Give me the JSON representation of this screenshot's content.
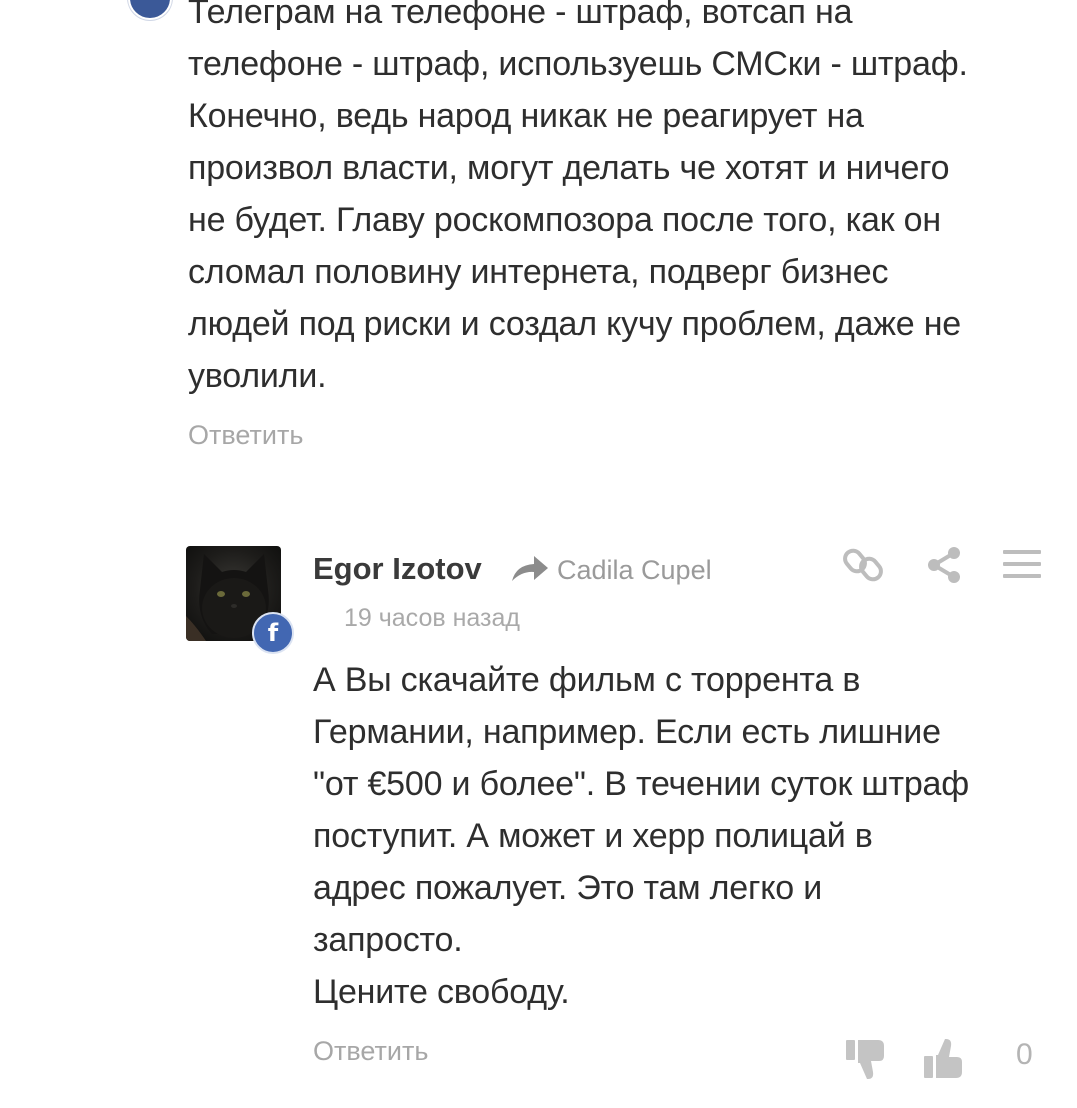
{
  "comment_prev": {
    "text_lines": [
      "Телеграм на телефоне - штраф, вотсап на",
      "телефоне - штраф, используешь СМСки - штраф.",
      "Конечно, ведь народ никак не реагирует на",
      "произвол власти, могут делать че хотят и ничего",
      "не будет. Главу роскомпозора после того, как он",
      "сломал половину интернета, подверг бизнес",
      "людей под риски и создал кучу проблем, даже не",
      "уволили."
    ],
    "reply_label": "Ответить"
  },
  "comment": {
    "author": "Egor Izotov",
    "reply_to": "Cadila Cupel",
    "time": "19 часов назад",
    "network_badge": "f",
    "text_lines": [
      "А Вы скачайте фильм с торрента в",
      "Германии, например. Если есть лишние",
      "\"от €500 и более\". В течении суток штраф",
      "поступит. А может и херр полицай в",
      "адрес пожалует. Это там легко и",
      "запросто.",
      "Цените свободу."
    ],
    "reply_label": "Ответить",
    "score": "0"
  },
  "icons": {
    "link": "link-icon",
    "share": "share-icon",
    "menu": "menu-icon",
    "reply_arrow": "reply-arrow-icon",
    "dislike": "thumbs-down-icon",
    "like": "thumbs-up-icon",
    "facebook": "facebook-icon"
  },
  "colors": {
    "facebook_blue": "#4267b2",
    "text": "#2e2e2e",
    "muted": "#a7a7a7"
  }
}
